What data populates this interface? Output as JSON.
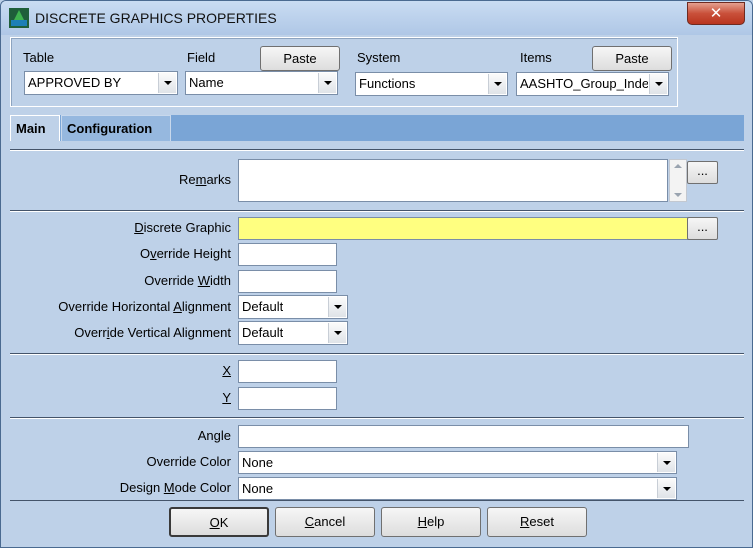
{
  "window": {
    "title": "DISCRETE GRAPHICS PROPERTIES",
    "close_label": "✕"
  },
  "selector": {
    "table_label": "Table",
    "table_value": "APPROVED BY",
    "field_label": "Field",
    "field_value": "Name",
    "paste_label": "Paste",
    "system_label": "System",
    "system_value": "Functions",
    "items_label": "Items",
    "items_value": "AASHTO_Group_Inde",
    "items_paste_label": "Paste"
  },
  "tabs": {
    "main": "Main",
    "configuration": "Configuration"
  },
  "remarks": {
    "label_pre": "Re",
    "label_key": "m",
    "label_post": "arks",
    "value": "",
    "browse": "..."
  },
  "graphic": {
    "discrete_pre": "",
    "discrete_key": "D",
    "discrete_post": "iscrete Graphic",
    "discrete_value": "",
    "browse": "...",
    "height_pre": "O",
    "height_key": "v",
    "height_post": "erride Height",
    "height_value": "",
    "width_pre": "Override ",
    "width_key": "W",
    "width_post": "idth",
    "width_value": "",
    "halign_pre": "Override Horizontal ",
    "halign_key": "A",
    "halign_post": "lignment",
    "halign_value": "Default",
    "valign_pre": "Overr",
    "valign_key": "i",
    "valign_post": "de Vertical Alignment",
    "valign_value": "Default"
  },
  "position": {
    "x_label": "X",
    "x_value": "",
    "y_label": "Y",
    "y_value": ""
  },
  "appearance": {
    "angle_pre": "An",
    "angle_key": "g",
    "angle_post": "le",
    "angle_value": "",
    "color_label": "Override Color",
    "color_value": "None",
    "design_pre": "Design ",
    "design_key": "M",
    "design_post": "ode Color",
    "design_value": "None"
  },
  "buttons": {
    "ok_key": "O",
    "ok_post": "K",
    "cancel_key": "C",
    "cancel_post": "ancel",
    "help_key": "H",
    "help_post": "elp",
    "reset_key": "R",
    "reset_post": "eset"
  },
  "colors": {
    "required_field": "#ffff80",
    "title_bar": "#c9dcf2",
    "tab_strip": "#7aa5d6"
  }
}
